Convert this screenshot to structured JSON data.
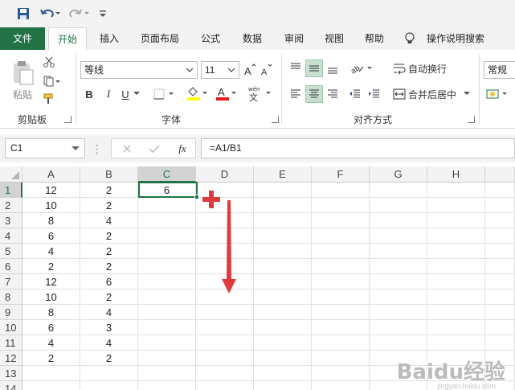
{
  "tabs": {
    "file": "文件",
    "home": "开始",
    "insert": "插入",
    "page_layout": "页面布局",
    "formulas": "公式",
    "data": "数据",
    "review": "审阅",
    "view": "视图",
    "help": "帮助",
    "tell_me": "操作说明搜索"
  },
  "ribbon": {
    "paste_label": "粘贴",
    "clipboard_group": "剪贴板",
    "font_name": "等线",
    "font_size": "11",
    "font_group": "字体",
    "bold": "B",
    "italic": "I",
    "underline": "U",
    "wrap_text": "自动换行",
    "merge_center": "合并后居中",
    "alignment_group": "对齐方式",
    "number_format": "常规",
    "accent_color": "#217346"
  },
  "formula_bar": {
    "name_box": "C1",
    "fx": "fx",
    "formula": "=A1/B1"
  },
  "sheet": {
    "columns": [
      "A",
      "B",
      "C",
      "D",
      "E",
      "F",
      "G",
      "H"
    ],
    "rows": [
      {
        "n": "1",
        "a": "12",
        "b": "2",
        "c": "6"
      },
      {
        "n": "2",
        "a": "10",
        "b": "2",
        "c": ""
      },
      {
        "n": "3",
        "a": "8",
        "b": "4",
        "c": ""
      },
      {
        "n": "4",
        "a": "6",
        "b": "2",
        "c": ""
      },
      {
        "n": "5",
        "a": "4",
        "b": "2",
        "c": ""
      },
      {
        "n": "6",
        "a": "2",
        "b": "2",
        "c": ""
      },
      {
        "n": "7",
        "a": "12",
        "b": "6",
        "c": ""
      },
      {
        "n": "8",
        "a": "10",
        "b": "2",
        "c": ""
      },
      {
        "n": "9",
        "a": "8",
        "b": "4",
        "c": ""
      },
      {
        "n": "10",
        "a": "6",
        "b": "3",
        "c": ""
      },
      {
        "n": "11",
        "a": "4",
        "b": "4",
        "c": ""
      },
      {
        "n": "12",
        "a": "2",
        "b": "2",
        "c": ""
      },
      {
        "n": "13",
        "a": "",
        "b": "",
        "c": ""
      },
      {
        "n": "14",
        "a": "",
        "b": "",
        "c": ""
      }
    ],
    "selected_column": "C",
    "selected_row": "1"
  },
  "annotation": {
    "color": "#e03a3e"
  },
  "watermark": {
    "text": "Baidu经验",
    "sub": "jingyan.baidu.com"
  }
}
